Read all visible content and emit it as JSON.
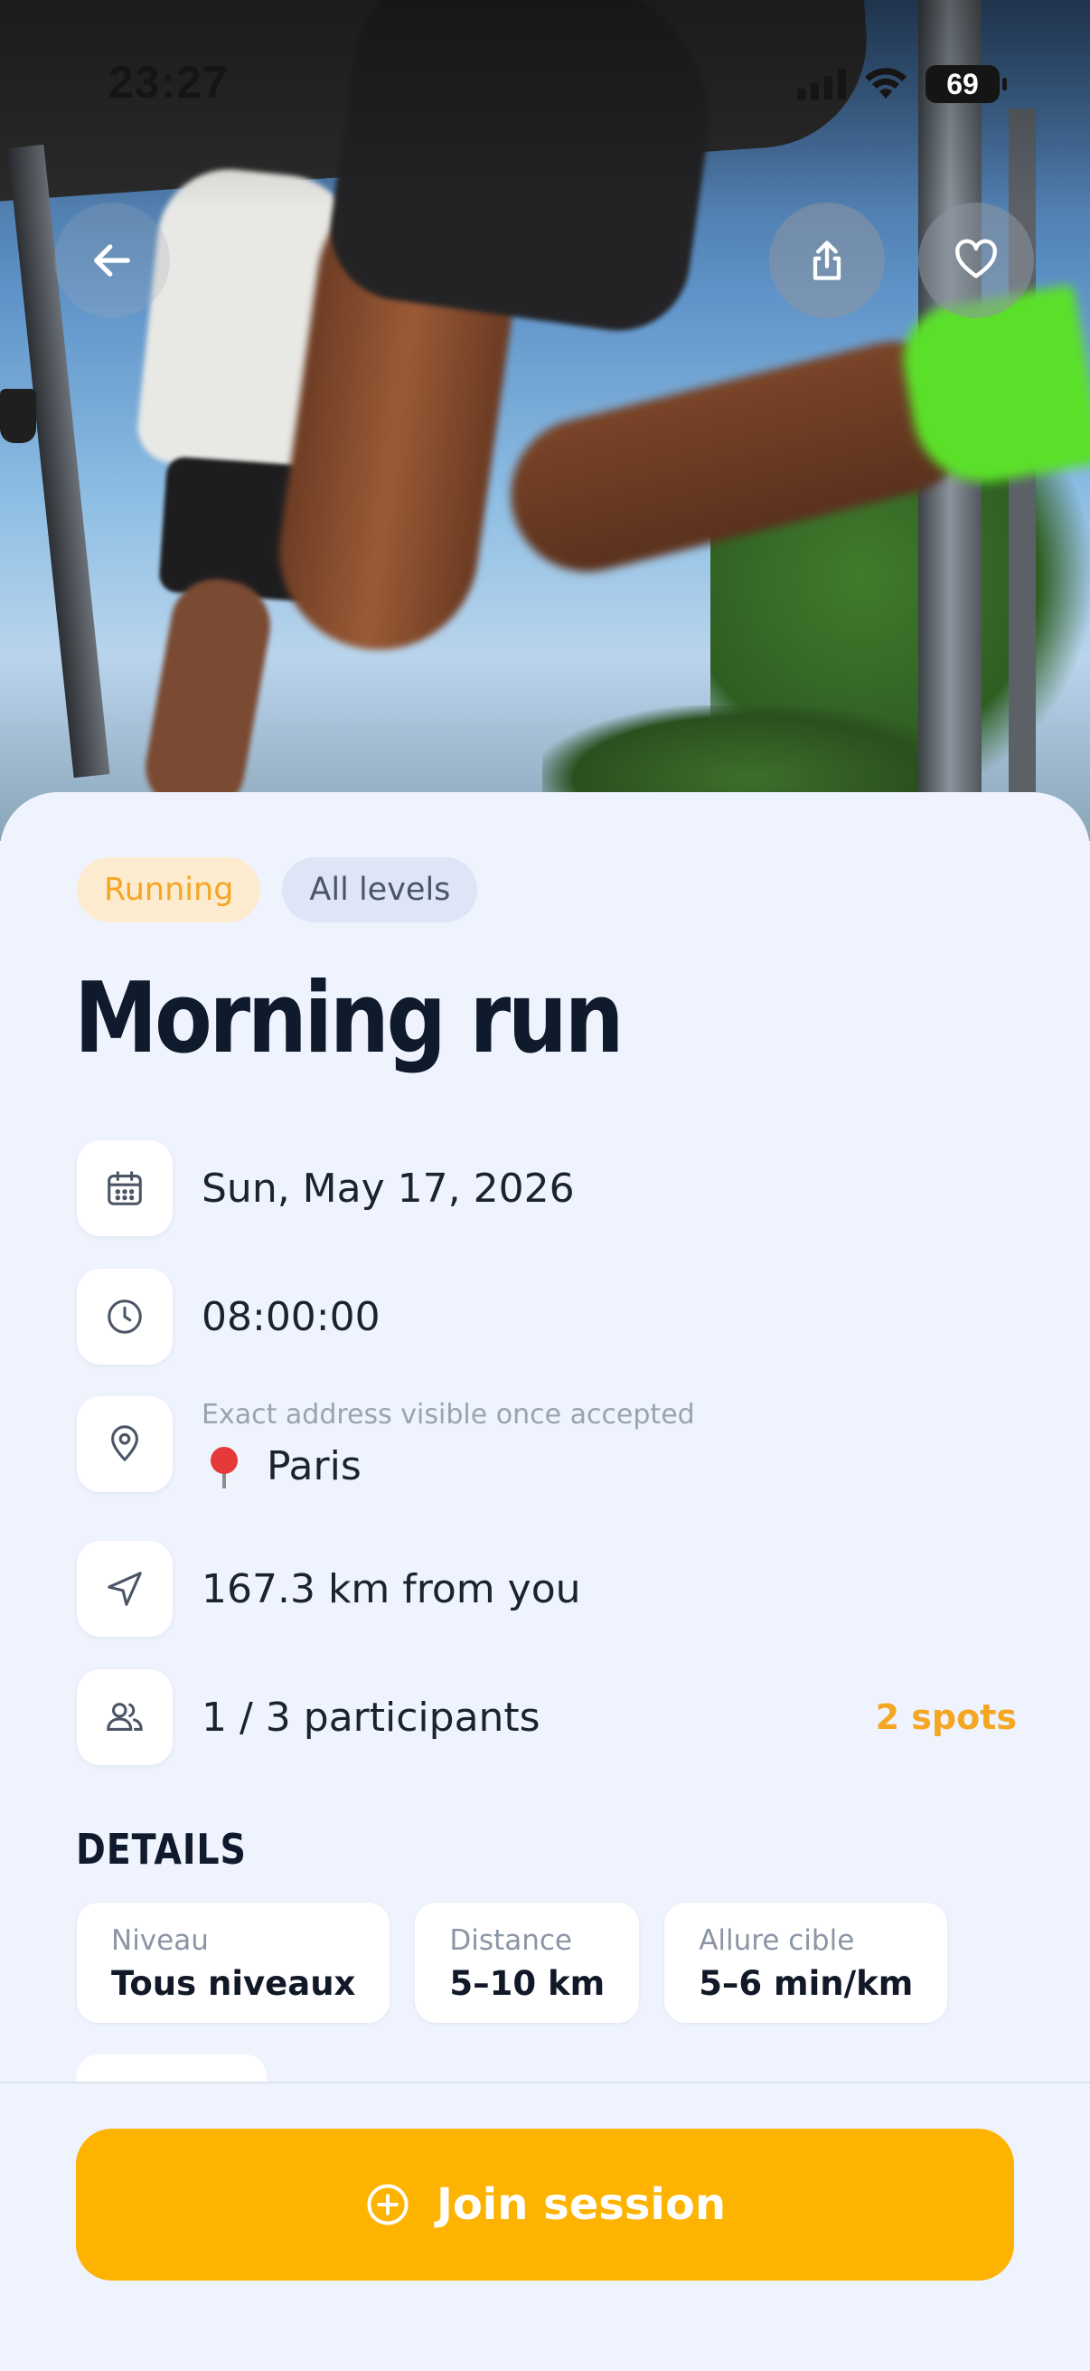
{
  "status_bar": {
    "time": "23:27",
    "battery": "69"
  },
  "tags": {
    "sport": "Running",
    "level": "All levels"
  },
  "title": "Morning run",
  "info": {
    "date": "Sun, May 17, 2026",
    "time": "08:00:00",
    "address_note": "Exact address visible once accepted",
    "city": "Paris",
    "distance": "167.3 km from you",
    "participants": "1 / 3 participants",
    "spots": "2 spots"
  },
  "details": {
    "heading": "DETAILS",
    "cards": [
      {
        "label": "Niveau",
        "value": "Tous niveaux"
      },
      {
        "label": "Distance",
        "value": "5–10 km"
      },
      {
        "label": "Allure cible",
        "value": "5–6 min/km"
      }
    ]
  },
  "cta": {
    "label": "Join session"
  },
  "icons": {
    "back": "arrow-left-icon",
    "share": "share-icon",
    "favorite": "heart-icon",
    "calendar": "calendar-icon",
    "clock": "clock-icon",
    "location": "map-pin-icon",
    "navigation": "navigation-arrow-icon",
    "users": "users-icon",
    "join": "plus-circle-icon"
  },
  "colors": {
    "accent": "#fdb300",
    "sport_tag_bg": "#fdebd0",
    "sport_tag_text": "#f5a623",
    "level_tag_bg": "#dde5f6",
    "background": "#eef3fd"
  }
}
